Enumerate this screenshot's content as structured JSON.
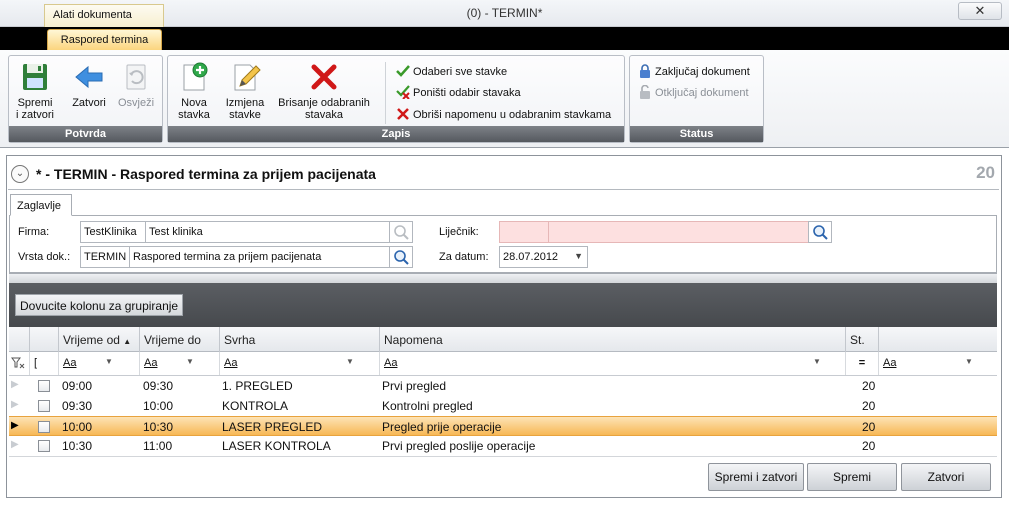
{
  "window": {
    "context_tab": "Alati dokumenta",
    "title": "(0) - TERMIN*",
    "close_glyph": "✕"
  },
  "ribbon": {
    "active_tab": "Raspored termina",
    "groups": {
      "potvrda": {
        "label": "Potvrda",
        "buttons": [
          {
            "label": "Spremi i zatvori",
            "icon": "save-close-icon"
          },
          {
            "label": "Zatvori",
            "icon": "back-arrow-icon"
          },
          {
            "label": "Osvježi",
            "icon": "refresh-icon",
            "disabled": true
          }
        ]
      },
      "zapis": {
        "label": "Zapis",
        "buttons": [
          {
            "label": "Nova stavka",
            "icon": "new-item-icon"
          },
          {
            "label": "Izmjena stavke",
            "icon": "edit-pencil-icon"
          },
          {
            "label": "Brisanje odabranih stavaka",
            "icon": "delete-x-icon"
          }
        ],
        "small_buttons": [
          {
            "label": "Odaberi sve stavke",
            "icon": "check-icon"
          },
          {
            "label": "Poništi odabir stavaka",
            "icon": "uncheck-icon"
          },
          {
            "label": "Obriši napomenu u odabranim stavkama",
            "icon": "red-x-icon"
          }
        ]
      },
      "status": {
        "label": "Status",
        "buttons": [
          {
            "label": "Zaključaj dokument",
            "icon": "lock-icon"
          },
          {
            "label": "Otključaj dokument",
            "icon": "unlock-icon",
            "disabled": true
          }
        ]
      }
    }
  },
  "document": {
    "title": "* - TERMIN - Raspored termina za prijem pacijenata",
    "count": "20",
    "tab": "Zaglavlje",
    "fields": {
      "firma": {
        "label": "Firma:",
        "code": "TestKlinika",
        "name": "Test klinika"
      },
      "vrsta": {
        "label": "Vrsta dok.:",
        "code": "TERMIN",
        "name": "Raspored termina za prijem pacijenata"
      },
      "lijecnik": {
        "label": "Liječnik:",
        "code": "",
        "name": ""
      },
      "za_datum": {
        "label": "Za datum:",
        "value": "28.07.2012"
      }
    }
  },
  "grid": {
    "group_hint": "Dovucite kolonu za grupiranje",
    "columns": [
      "Vrijeme od",
      "Vrijeme do",
      "Svrha",
      "Napomena",
      "St."
    ],
    "filter_glyph": "Aa",
    "rows": [
      {
        "od": "09:00",
        "do": "09:30",
        "svrha": "1. PREGLED",
        "napomena": "Prvi pregled",
        "st": "20"
      },
      {
        "od": "09:30",
        "do": "10:00",
        "svrha": "KONTROLA",
        "napomena": "Kontrolni pregled",
        "st": "20"
      },
      {
        "od": "10:00",
        "do": "10:30",
        "svrha": "LASER PREGLED",
        "napomena": "Pregled prije operacije",
        "st": "20"
      },
      {
        "od": "10:30",
        "do": "11:00",
        "svrha": "LASER KONTROLA",
        "napomena": "Prvi pregled poslije operacije",
        "st": "20"
      }
    ],
    "selected_row": 2
  },
  "footer": {
    "save_close": "Spremi i zatvori",
    "save": "Spremi",
    "close": "Zatvori"
  },
  "colors": {
    "selected_row": "#f7b856",
    "ribbon_tab": "#fbd37a",
    "required_field": "#fde0e0"
  }
}
